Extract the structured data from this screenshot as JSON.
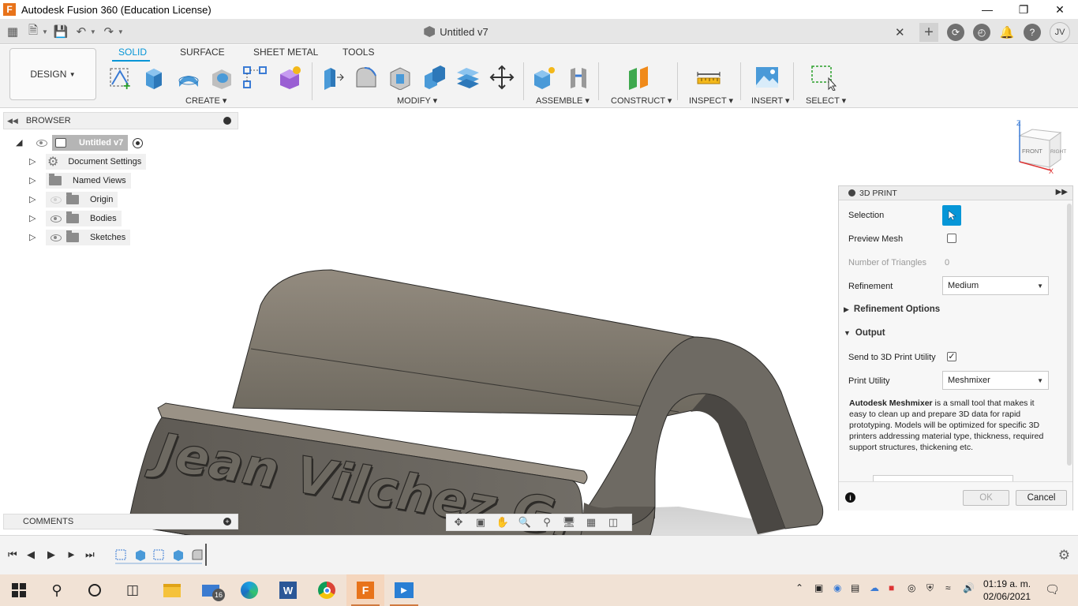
{
  "window": {
    "title": "Autodesk Fusion 360 (Education License)",
    "app_icon_letter": "F"
  },
  "document_tab": {
    "title": "Untitled v7"
  },
  "user": {
    "initials": "JV"
  },
  "ribbon": {
    "workspace_label": "DESIGN",
    "tabs": [
      {
        "label": "SOLID",
        "active": true
      },
      {
        "label": "SURFACE",
        "active": false
      },
      {
        "label": "SHEET METAL",
        "active": false
      },
      {
        "label": "TOOLS",
        "active": false
      }
    ],
    "groups": {
      "create": "CREATE",
      "modify": "MODIFY",
      "assemble": "ASSEMBLE",
      "construct": "CONSTRUCT",
      "inspect": "INSPECT",
      "insert": "INSERT",
      "select": "SELECT"
    }
  },
  "browser": {
    "title": "BROWSER",
    "root": "Untitled v7",
    "items": [
      {
        "label": "Document Settings",
        "icon": "gear-icon"
      },
      {
        "label": "Named Views",
        "icon": "folder-icon"
      },
      {
        "label": "Origin",
        "icon": "folder-icon",
        "hidden": true
      },
      {
        "label": "Bodies",
        "icon": "folder-icon"
      },
      {
        "label": "Sketches",
        "icon": "folder-icon"
      }
    ]
  },
  "model": {
    "engraved_text": "Jean Vilchez G."
  },
  "viewcube": {
    "front": "FRONT",
    "right": "RIGHT",
    "axis_z": "Z",
    "axis_x": "X"
  },
  "print_panel": {
    "title": "3D PRINT",
    "selection_label": "Selection",
    "preview_mesh_label": "Preview Mesh",
    "preview_mesh_checked": false,
    "triangles_label": "Number of Triangles",
    "triangles_value": "0",
    "refinement_label": "Refinement",
    "refinement_value": "Medium",
    "refinement_options_label": "Refinement Options",
    "output_label": "Output",
    "send_label": "Send to 3D Print Utility",
    "send_checked": true,
    "utility_label": "Print Utility",
    "utility_value": "Meshmixer",
    "description_bold": "Autodesk Meshmixer",
    "description_rest": " is a small tool that makes it easy to clean up and prepare 3D data for rapid prototyping. Models will be optimized for specific 3D printers addressing material type, thickness, required support structures, thickening etc.",
    "ok_label": "OK",
    "cancel_label": "Cancel"
  },
  "comments": {
    "title": "COMMENTS"
  },
  "taskbar": {
    "mail_badge": "16",
    "time": "01:19 a. m.",
    "date": "02/06/2021"
  },
  "colors": {
    "accent": "#0696d7",
    "model_top": "#8a8275",
    "model_side": "#6f6a62",
    "taskbar": "#f1e2d5"
  }
}
